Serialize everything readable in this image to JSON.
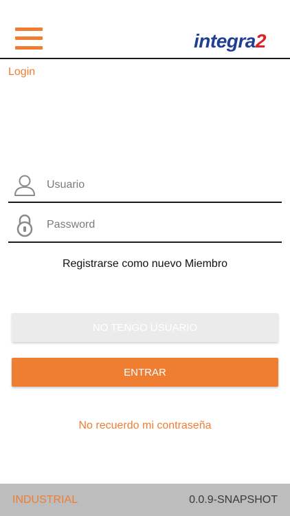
{
  "header": {
    "menu_icon": "hamburger-menu-icon",
    "logo": {
      "text": "integra",
      "number": "2",
      "brand_blue": "#1f3f96",
      "brand_red": "#e02121"
    }
  },
  "page": {
    "title": "Login"
  },
  "form": {
    "username": {
      "placeholder": "Usuario",
      "value": "",
      "icon": "user-icon"
    },
    "password": {
      "placeholder": "Password",
      "value": "",
      "icon": "lock-icon"
    },
    "register_label": "Registrarse como nuevo Miembro"
  },
  "buttons": {
    "no_user_label": "NO TENGO USUARIO",
    "enter_label": "ENTRAR"
  },
  "forgot_password_label": "No recuerdo mi contraseña",
  "footer": {
    "environment": "INDUSTRIAL",
    "version": "0.0.9-SNAPSHOT"
  },
  "colors": {
    "accent": "#ef7d32",
    "disabled_button": "#ebebeb",
    "footer_bg": "#bdbdbd"
  }
}
